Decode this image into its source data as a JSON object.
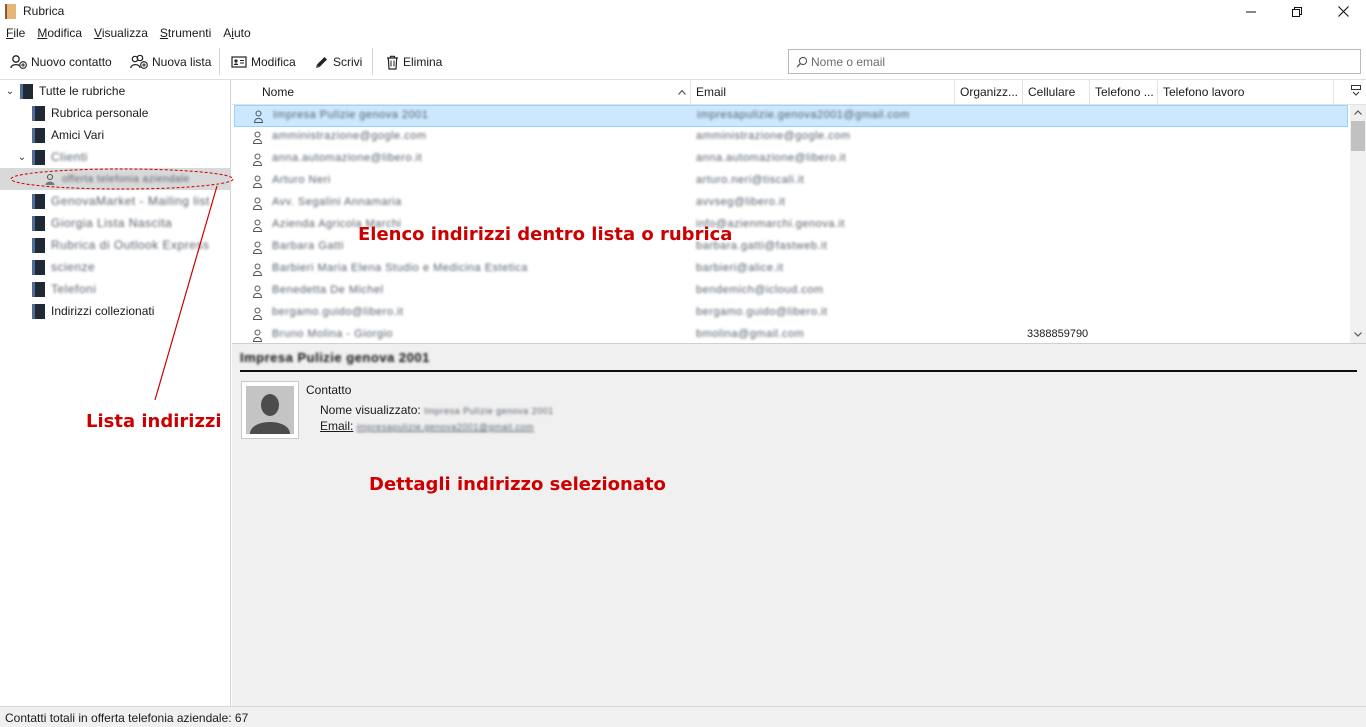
{
  "window": {
    "title": "Rubrica"
  },
  "menubar": [
    {
      "mn": "F",
      "rest": "ile"
    },
    {
      "mn": "M",
      "rest": "odifica"
    },
    {
      "mn": "V",
      "rest": "isualizza"
    },
    {
      "mn": "S",
      "rest": "trumenti"
    },
    {
      "pre": "A",
      "mn": "i",
      "rest": "uto"
    }
  ],
  "toolbar": {
    "new_contact": "Nuovo contatto",
    "new_list": "Nuova lista",
    "edit": "Modifica",
    "write": "Scrivi",
    "delete": "Elimina"
  },
  "search": {
    "placeholder": "Nome o email"
  },
  "sidebar": {
    "root": "Tutte le rubriche",
    "items": [
      {
        "label": "Rubrica personale"
      },
      {
        "label": "Amici Vari"
      },
      {
        "label": "Clienti"
      },
      {
        "label": "offerta telefonia aziendale"
      },
      {
        "label": "GenovaMarket - Mailing list"
      },
      {
        "label": "Giorgia Lista Nascita"
      },
      {
        "label": "Rubrica di Outlook Express"
      },
      {
        "label": "scienze"
      },
      {
        "label": "Telefoni"
      },
      {
        "label": "Indirizzi collezionati"
      }
    ]
  },
  "columns": {
    "name": "Nome",
    "email": "Email",
    "org": "Organizz...",
    "mobile": "Cellulare",
    "phone": "Telefono ...",
    "work_phone": "Telefono lavoro"
  },
  "contacts": [
    {
      "name": "Impresa Pulizie genova 2001",
      "email": "impresapulizie.genova2001@gmail.com"
    },
    {
      "name": "amministrazione@gogle.com",
      "email": "amministrazione@gogle.com"
    },
    {
      "name": "anna.automazione@libero.it",
      "email": "anna.automazione@libero.it"
    },
    {
      "name": "Arturo Neri",
      "email": "arturo.neri@tiscali.it"
    },
    {
      "name": "Avv. Segalini Annamaria",
      "email": "avvseg@libero.it"
    },
    {
      "name": "Azienda Agricola Marchi",
      "email": "info@azienmarchi.genova.it"
    },
    {
      "name": "Barbara Gatti",
      "email": "barbara.gatti@fastweb.it"
    },
    {
      "name": "Barbieri Maria Elena Studio e Medicina Estetica",
      "email": "barbieri@alice.it"
    },
    {
      "name": "Benedetta De Michel",
      "email": "bendemich@icloud.com"
    },
    {
      "name": "bergamo.guido@libero.it",
      "email": "bergamo.guido@libero.it"
    },
    {
      "name": "Bruno Molina - Giorgio",
      "email": "bmolina@gmail.com",
      "mobile": "3388859790"
    }
  ],
  "detail": {
    "heading": "Impresa Pulizie genova 2001",
    "section": "Contatto",
    "display_name_label": "Nome visualizzato:",
    "display_name_value": "Impresa Pulizie genova 2001",
    "email_label": "Email:",
    "email_value": "impresapulizie.genova2001@gmail.com"
  },
  "annotations": {
    "list_label": "Lista indirizzi",
    "contacts_label": "Elenco indirizzi dentro lista o rubrica",
    "detail_label": "Dettagli indirizzo selezionato"
  },
  "status": {
    "text": "Contatti totali in offerta telefonia aziendale: 67"
  }
}
